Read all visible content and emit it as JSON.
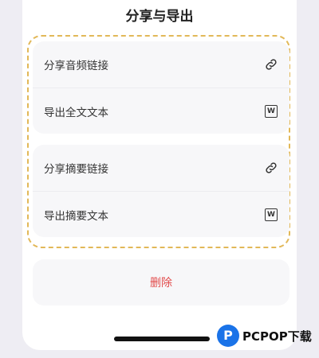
{
  "sheet": {
    "title": "分享与导出"
  },
  "group1": {
    "items": [
      {
        "label": "分享音频链接",
        "icon": "link-icon"
      },
      {
        "label": "导出全文文本",
        "icon": "word-doc-icon"
      }
    ]
  },
  "group2": {
    "items": [
      {
        "label": "分享摘要链接",
        "icon": "link-icon"
      },
      {
        "label": "导出摘要文本",
        "icon": "word-doc-icon"
      }
    ]
  },
  "delete_label": "删除",
  "word_icon_letter": "W",
  "watermark": {
    "logo_letter": "P",
    "text": "PCPOP下载"
  },
  "colors": {
    "dashed_border": "#e2b858",
    "delete_text": "#e24b4b",
    "background": "#eeedf3"
  }
}
